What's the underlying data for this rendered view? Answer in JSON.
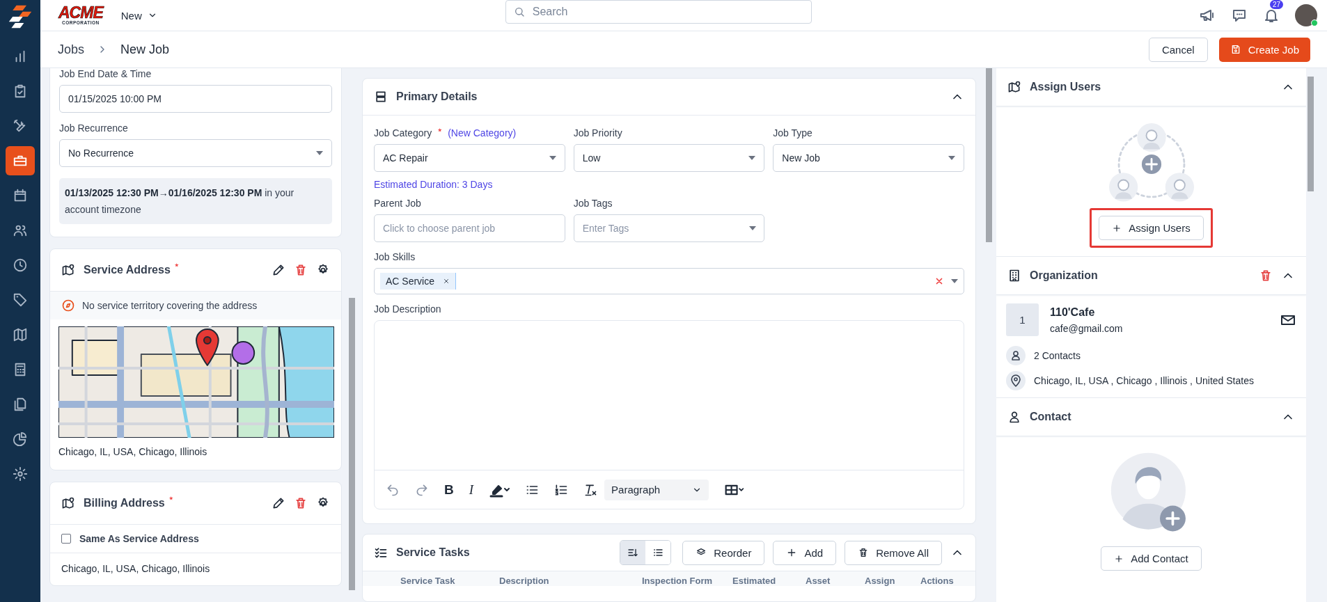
{
  "nav": [
    {
      "selected": false
    },
    {
      "selected": false
    },
    {
      "selected": false
    },
    {
      "selected": true
    },
    {
      "selected": false
    },
    {
      "selected": false
    },
    {
      "selected": false
    },
    {
      "selected": false
    },
    {
      "selected": false
    },
    {
      "selected": false
    },
    {
      "selected": false
    },
    {
      "selected": false
    },
    {
      "selected": false
    }
  ],
  "header": {
    "logo": {
      "title": "ACME",
      "subtitle": "CORPORATION"
    },
    "new_menu": "New",
    "search": {
      "placeholder": "Search"
    },
    "notifications": {
      "count": "27"
    },
    "avatar": {
      "online": true
    }
  },
  "breadcrumb": [
    "Jobs",
    "New Job"
  ],
  "actions": [
    {
      "label": "Cancel",
      "kind": "secondary"
    },
    {
      "label": "Create Job",
      "kind": "primary"
    }
  ],
  "schedule": {
    "fields": [
      {
        "label": "Job End Date & Time",
        "value": "01/15/2025 10:00 PM",
        "kind": "input"
      },
      {
        "label": "Job Recurrence",
        "value": "No Recurrence",
        "kind": "select"
      }
    ],
    "summary": "**01/13/2025 12:30 PM→01/16/2025 12:30 PM** in your account timezone"
  },
  "service_address": {
    "title": "Service Address",
    "required": true,
    "notice": "No service territory covering the address",
    "address": "Chicago, IL, USA, Chicago, Illinois"
  },
  "billing_address": {
    "title": "Billing Address",
    "required": true,
    "same_as_service": {
      "label": "Same As Service Address",
      "checked": false
    },
    "address": "Chicago, IL, USA, Chicago, Illinois"
  },
  "primary_details": {
    "title": "Primary Details",
    "expanded": true,
    "job_category": {
      "label": "Job Category",
      "required": true,
      "link": "(New Category)",
      "value": "AC Repair",
      "hint": "Estimated Duration: 3 Days"
    },
    "job_priority": {
      "label": "Job Priority",
      "value": "Low"
    },
    "job_type": {
      "label": "Job Type",
      "value": "New Job"
    },
    "parent_job": {
      "label": "Parent Job",
      "placeholder": "Click to choose parent job"
    },
    "job_tags": {
      "label": "Job Tags",
      "placeholder": "Enter Tags"
    },
    "job_skills": {
      "label": "Job Skills",
      "tags": [
        "AC Service"
      ]
    },
    "job_description": {
      "label": "Job Description",
      "toolbar": {
        "bold": "B",
        "italic": "I",
        "format": "Paragraph"
      }
    }
  },
  "service_tasks": {
    "title": "Service Tasks",
    "expanded": true,
    "view_modes": [
      {
        "selected": true
      },
      {
        "selected": false
      }
    ],
    "buttons": [
      {
        "label": "Reorder",
        "kind": "reorder"
      },
      {
        "label": "Add",
        "kind": "add"
      },
      {
        "label": "Remove All",
        "kind": "remove"
      }
    ],
    "columns": [
      "Service Task",
      "Description",
      "Inspection Form",
      "Estimated",
      "Asset",
      "Assign",
      "Actions"
    ]
  },
  "assign_users": {
    "title": "Assign Users",
    "expanded": true,
    "button": "Assign Users",
    "highlighted": true
  },
  "organization": {
    "title": "Organization",
    "expanded": true,
    "avatar": "1",
    "name": "110'Cafe",
    "email": "cafe@gmail.com",
    "contacts": "2 Contacts",
    "address": "Chicago, IL, USA , Chicago , Illinois , United States"
  },
  "contact": {
    "title": "Contact",
    "expanded": true,
    "button": "Add Contact"
  }
}
